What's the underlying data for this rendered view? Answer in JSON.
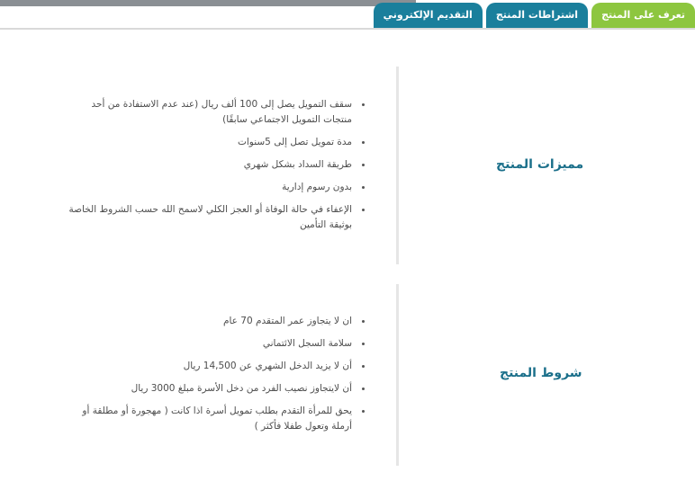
{
  "tabs": [
    {
      "label": "تعرف على المنتج",
      "active": true
    },
    {
      "label": "اشتراطات المنتج",
      "active": false
    },
    {
      "label": "التقديم الإلكتروني",
      "active": false
    }
  ],
  "features": {
    "title": "مميزات المنتج",
    "items": [
      "سقف التمويل يصل إلى 100 ألف ريال (عند عدم الاستفادة من أحد منتجات التمويل الاجتماعي سابقًا)",
      "مدة تمويل تصل إلى 5سنوات",
      "طريقة السداد بشكل شهري",
      "بدون رسوم إدارية",
      "الإعفاء في حالة الوفاة أو العجز الكلي لاسمح الله حسب الشروط الخاصة بوثيقة التأمين"
    ]
  },
  "conditions": {
    "title": "شروط المنتج",
    "items": [
      "ان لا يتجاوز عمر المتقدم 70 عام",
      "سلامة السجل الائتماني",
      "أن لا يزيد الدخل الشهري عن 14,500 ريال",
      "أن لايتجاوز نصيب الفرد من دخل الأسرة مبلغ 3000 ريال",
      "يحق للمرأة التقدم بطلب تمويل أسرة اذا كانت ( مهجورة أو مطلقة أو أرملة وتعول طفلا فأكثر )"
    ]
  },
  "colors": {
    "active_tab": "#8dc63f",
    "tab": "#1a7f9c",
    "title": "#1a6f8a"
  }
}
